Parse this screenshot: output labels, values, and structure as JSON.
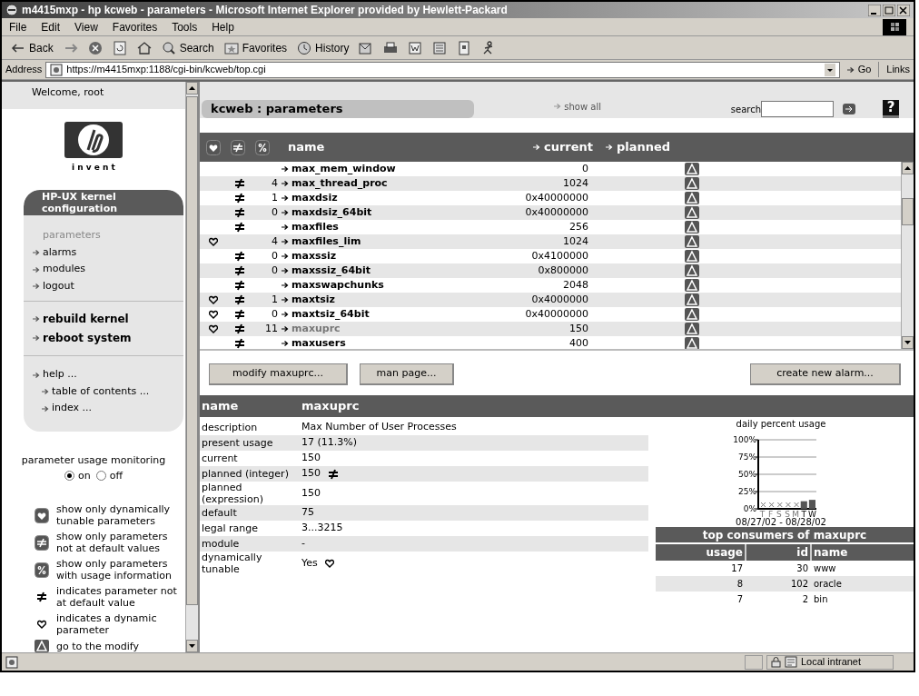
{
  "window": {
    "title": "m4415mxp - hp kcweb - parameters - Microsoft Internet Explorer provided by Hewlett-Packard"
  },
  "menu": [
    "File",
    "Edit",
    "View",
    "Favorites",
    "Tools",
    "Help"
  ],
  "toolbar": [
    {
      "kind": "back",
      "label": "Back"
    },
    {
      "kind": "forward"
    },
    {
      "kind": "stop"
    },
    {
      "kind": "refresh"
    },
    {
      "kind": "home"
    },
    {
      "kind": "search",
      "label": "Search"
    },
    {
      "kind": "favorites",
      "label": "Favorites"
    },
    {
      "kind": "history",
      "label": "History"
    },
    {
      "kind": "mail"
    },
    {
      "kind": "print"
    },
    {
      "kind": "edit"
    },
    {
      "kind": "discuss"
    },
    {
      "kind": "messenger"
    },
    {
      "kind": "person"
    }
  ],
  "address": {
    "label": "Address",
    "url": "https://m4415mxp:1188/cgi-bin/kcweb/top.cgi",
    "go": "Go",
    "links": "Links"
  },
  "sidebar": {
    "welcome": "Welcome, root",
    "logo_tagline": "i n v e n t",
    "box_title": "HP-UX kernel configuration",
    "nav": [
      {
        "label": "parameters",
        "selected": true
      },
      {
        "label": "alarms",
        "selected": false
      },
      {
        "label": "modules",
        "selected": false
      },
      {
        "label": "logout",
        "selected": false
      }
    ],
    "actions": [
      "rebuild kernel",
      "reboot system"
    ],
    "help": {
      "label": "help ...",
      "children": [
        {
          "label": "table of contents ..."
        },
        {
          "label": "index ..."
        }
      ]
    },
    "monitoring": {
      "label": "parameter usage monitoring",
      "options": [
        {
          "label": "on",
          "selected": true
        },
        {
          "label": "off",
          "selected": false
        }
      ]
    },
    "legend": [
      {
        "kind": "dynamic-filter",
        "text": "show only dynamically tunable parameters"
      },
      {
        "kind": "default-filter",
        "text": "show only parameters not at default values"
      },
      {
        "kind": "usage-filter",
        "text": "show only parameters with usage information"
      },
      {
        "kind": "not-default",
        "text": "indicates parameter not at default value"
      },
      {
        "kind": "dynamic",
        "text": "indicates a dynamic parameter"
      },
      {
        "kind": "modify",
        "text": "go to the modify"
      }
    ]
  },
  "page": {
    "title": "kcweb : parameters",
    "show_all": "show all",
    "search": {
      "label": "search"
    },
    "help": "?"
  },
  "table": {
    "columns": [
      "name",
      "current",
      "planned"
    ],
    "rows": [
      {
        "dynamic": false,
        "not_default": false,
        "name": "max_mem_window",
        "current": "0",
        "selected": false
      },
      {
        "dynamic": false,
        "not_default": true,
        "usage": "4",
        "name": "max_thread_proc",
        "current": "1024",
        "selected": false
      },
      {
        "dynamic": false,
        "not_default": true,
        "usage": "1",
        "name": "maxdsiz",
        "current": "0x40000000",
        "selected": false
      },
      {
        "dynamic": false,
        "not_default": true,
        "usage": "0",
        "name": "maxdsiz_64bit",
        "current": "0x40000000",
        "selected": false
      },
      {
        "dynamic": false,
        "not_default": true,
        "name": "maxfiles",
        "current": "256",
        "selected": false
      },
      {
        "dynamic": true,
        "not_default": false,
        "usage": "4",
        "name": "maxfiles_lim",
        "current": "1024",
        "selected": false
      },
      {
        "dynamic": false,
        "not_default": true,
        "usage": "0",
        "name": "maxssiz",
        "current": "0x4100000",
        "selected": false
      },
      {
        "dynamic": false,
        "not_default": true,
        "usage": "0",
        "name": "maxssiz_64bit",
        "current": "0x800000",
        "selected": false
      },
      {
        "dynamic": false,
        "not_default": true,
        "name": "maxswapchunks",
        "current": "2048",
        "selected": false
      },
      {
        "dynamic": true,
        "not_default": true,
        "usage": "1",
        "name": "maxtsiz",
        "current": "0x4000000",
        "selected": false
      },
      {
        "dynamic": true,
        "not_default": true,
        "usage": "0",
        "name": "maxtsiz_64bit",
        "current": "0x40000000",
        "selected": false
      },
      {
        "dynamic": true,
        "not_default": true,
        "usage": "11",
        "name": "maxuprc",
        "current": "150",
        "selected": true
      },
      {
        "dynamic": false,
        "not_default": true,
        "name": "maxusers",
        "current": "400",
        "selected": false
      }
    ]
  },
  "buttons": {
    "modify": "modify maxuprc...",
    "man": "man page...",
    "alarm": "create new alarm..."
  },
  "details": {
    "header": [
      "name",
      "maxuprc"
    ],
    "rows": [
      {
        "kind": "text",
        "label": "description",
        "value": "Max Number of User Processes"
      },
      {
        "kind": "text",
        "label": "present usage",
        "value": "17 (11.3%)"
      },
      {
        "kind": "text",
        "label": "current",
        "value": "150"
      },
      {
        "kind": "not-default",
        "label": "planned (integer)",
        "value": "150"
      },
      {
        "kind": "text",
        "label": "planned (expression)",
        "value": "150"
      },
      {
        "kind": "text",
        "label": "default",
        "value": "75"
      },
      {
        "kind": "text",
        "label": "legal range",
        "value": "3...3215"
      },
      {
        "kind": "text",
        "label": "module",
        "value": "-"
      },
      {
        "kind": "dynamic",
        "label": "dynamically tunable",
        "value": "Yes"
      }
    ]
  },
  "usage_chart": {
    "chart_data": {
      "type": "bar",
      "title": "daily percent usage",
      "xlabel": "08/27/02 - 08/28/02",
      "categories": [
        "T",
        "F",
        "S",
        "S",
        "M",
        "T",
        "W"
      ],
      "values": [
        null,
        null,
        null,
        null,
        null,
        11,
        13
      ],
      "ylim": [
        0,
        100
      ],
      "grid": true,
      "yticks": [
        {
          "value": 0,
          "label": "0%"
        },
        {
          "value": 25,
          "label": "25%"
        },
        {
          "value": 50,
          "label": "50%"
        },
        {
          "value": 75,
          "label": "75%"
        },
        {
          "value": 100,
          "label": "100%"
        }
      ]
    }
  },
  "consumers": {
    "title": "top consumers of maxuprc",
    "columns": [
      "usage",
      "id",
      "name"
    ],
    "rows": [
      [
        "17",
        "30",
        "www"
      ],
      [
        "8",
        "102",
        "oracle"
      ],
      [
        "7",
        "2",
        "bin"
      ]
    ]
  },
  "status_bar": {
    "zone": "Local intranet"
  }
}
